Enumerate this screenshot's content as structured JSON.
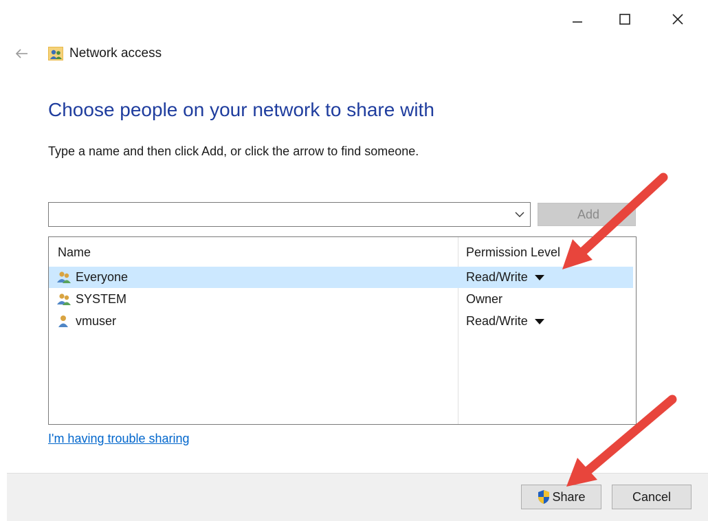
{
  "window": {
    "title": "Network access",
    "controls": {
      "minimize_icon": "minimize-icon",
      "maximize_icon": "maximize-icon",
      "close_icon": "close-icon"
    }
  },
  "header": {
    "back_icon": "back-arrow-icon",
    "app_icon": "network-users-icon"
  },
  "main": {
    "heading": "Choose people on your network to share with",
    "instruction": "Type a name and then click Add, or click the arrow to find someone.",
    "name_input": {
      "value": "",
      "placeholder": ""
    },
    "add_label": "Add"
  },
  "share_list": {
    "columns": [
      "Name",
      "Permission Level"
    ],
    "rows": [
      {
        "name": "Everyone",
        "permission": "Read/Write",
        "icon": "user-group-icon",
        "has_dropdown": true,
        "selected": true
      },
      {
        "name": "SYSTEM",
        "permission": "Owner",
        "icon": "user-group-icon",
        "has_dropdown": false,
        "selected": false
      },
      {
        "name": "vmuser",
        "permission": "Read/Write",
        "icon": "user-icon",
        "has_dropdown": true,
        "selected": false
      }
    ]
  },
  "links": {
    "trouble": "I'm having trouble sharing"
  },
  "footer": {
    "share_label": "Share",
    "cancel_label": "Cancel",
    "share_icon": "uac-shield-icon"
  },
  "colors": {
    "heading": "#1f3d9e",
    "link": "#0066cc",
    "selection": "#cce8ff",
    "annotation_arrow": "#e8453c"
  }
}
